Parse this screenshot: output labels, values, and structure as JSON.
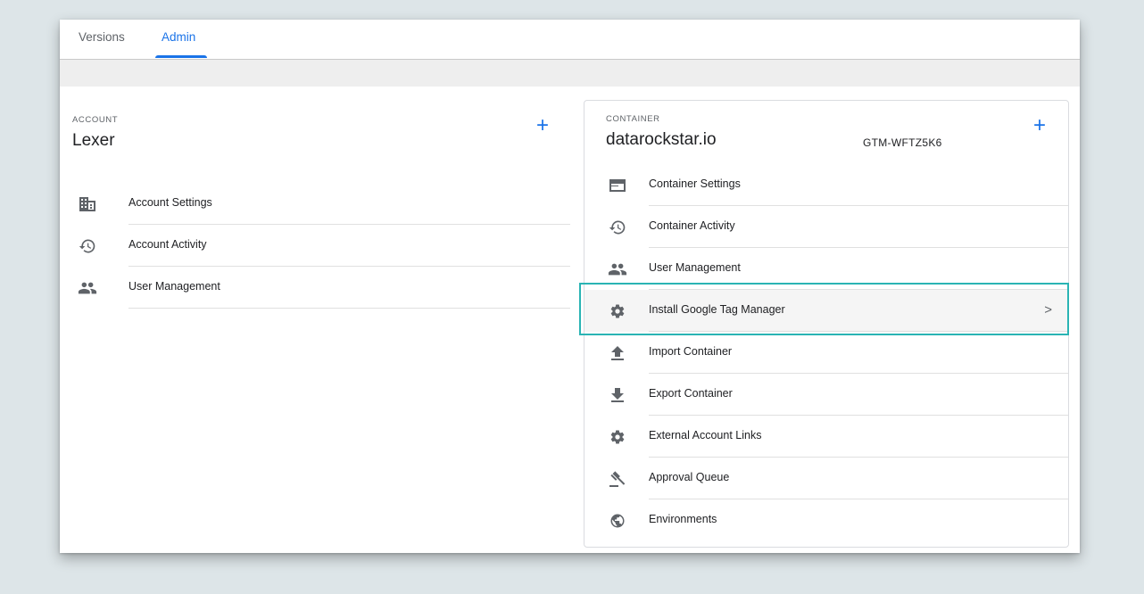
{
  "tabs": [
    {
      "label": "Versions"
    },
    {
      "label": "Admin",
      "active": true
    }
  ],
  "account": {
    "section_label": "ACCOUNT",
    "name": "Lexer",
    "add_symbol": "+",
    "items": [
      {
        "label": "Account Settings",
        "icon": "building-icon"
      },
      {
        "label": "Account Activity",
        "icon": "history-icon"
      },
      {
        "label": "User Management",
        "icon": "people-icon"
      }
    ]
  },
  "container": {
    "section_label": "CONTAINER",
    "name": "datarockstar.io",
    "id": "GTM-WFTZ5K6",
    "add_symbol": "+",
    "items": [
      {
        "label": "Container Settings",
        "icon": "window-icon"
      },
      {
        "label": "Container Activity",
        "icon": "history-icon"
      },
      {
        "label": "User Management",
        "icon": "people-icon"
      },
      {
        "label": "Install Google Tag Manager",
        "icon": "gear-icon",
        "chevron": ">"
      },
      {
        "label": "Import Container",
        "icon": "upload-icon"
      },
      {
        "label": "Export Container",
        "icon": "download-icon"
      },
      {
        "label": "External Account Links",
        "icon": "gear-icon"
      },
      {
        "label": "Approval Queue",
        "icon": "gavel-icon"
      },
      {
        "label": "Environments",
        "icon": "globe-icon"
      }
    ]
  },
  "colors": {
    "accent": "#1a73e8",
    "highlight_border": "#2ab4b4",
    "background": "#dde5e8"
  }
}
